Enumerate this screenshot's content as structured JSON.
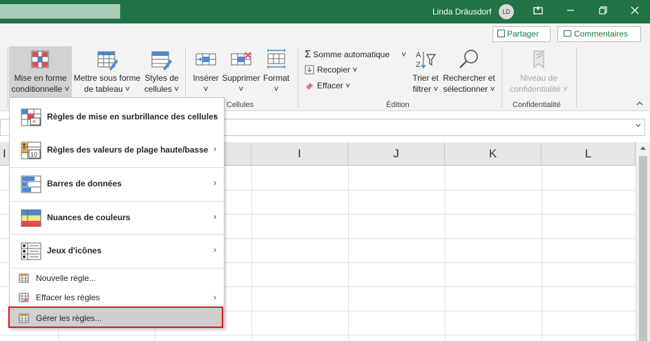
{
  "titlebar": {
    "user_name": "Linda Dräusdorf",
    "avatar_initials": "LD",
    "minimize": "🗗",
    "restore": "⧉",
    "close": "✕"
  },
  "ribbon": {
    "share_label": "Partager",
    "comments_label": "Commentaires",
    "styles_group": {
      "cond_format_line1": "Mise en forme",
      "cond_format_line2": "conditionnelle ˅",
      "format_table_line1": "Mettre sous forme",
      "format_table_line2": "de tableau ˅",
      "cell_styles_line1": "Styles de",
      "cell_styles_line2": "cellules ˅"
    },
    "cells_group": {
      "insert_line1": "Insérer",
      "insert_line2": "˅",
      "delete_line1": "Supprimer",
      "delete_line2": "˅",
      "format_line1": "Format",
      "format_line2": "˅",
      "label": "Cellules"
    },
    "editing_group": {
      "autosum": "Somme automatique",
      "autosum_arrow": "˅",
      "fill": "Recopier ˅",
      "clear": "Effacer ˅",
      "sort_line1": "Trier et",
      "sort_line2": "filtrer ˅",
      "find_line1": "Rechercher et",
      "find_line2": "sélectionner ˅",
      "label": "Édition"
    },
    "sensitivity_group": {
      "level_line1": "Niveau de",
      "level_line2": "confidentialité ˅",
      "label": "Confidentialité"
    }
  },
  "grid": {
    "columns": [
      "I",
      "J",
      "K",
      "L"
    ],
    "partial_column": "I"
  },
  "menu": {
    "items_big": [
      {
        "label": "Règles de mise en surbrillance des cellules",
        "has_submenu": true,
        "icon": "highlight-rules-icon"
      },
      {
        "label": "Règles des valeurs de plage haute/basse",
        "has_submenu": true,
        "icon": "top-bottom-rules-icon"
      },
      {
        "label": "Barres de données",
        "has_submenu": true,
        "icon": "data-bars-icon"
      },
      {
        "label": "Nuances de couleurs",
        "has_submenu": true,
        "icon": "color-scales-icon"
      },
      {
        "label": "Jeux d'icônes",
        "has_submenu": true,
        "icon": "icon-sets-icon"
      }
    ],
    "items_small": [
      {
        "label": "Nouvelle règle...",
        "has_submenu": false
      },
      {
        "label": "Effacer les règles",
        "has_submenu": true
      },
      {
        "label": "Gérer les règles...",
        "has_submenu": false,
        "selected": true
      }
    ],
    "top_bottom_icon_text": "10",
    "chevron": "›"
  },
  "colors": {
    "title_green": "#217346",
    "accent_highlight": "#e0141e"
  }
}
